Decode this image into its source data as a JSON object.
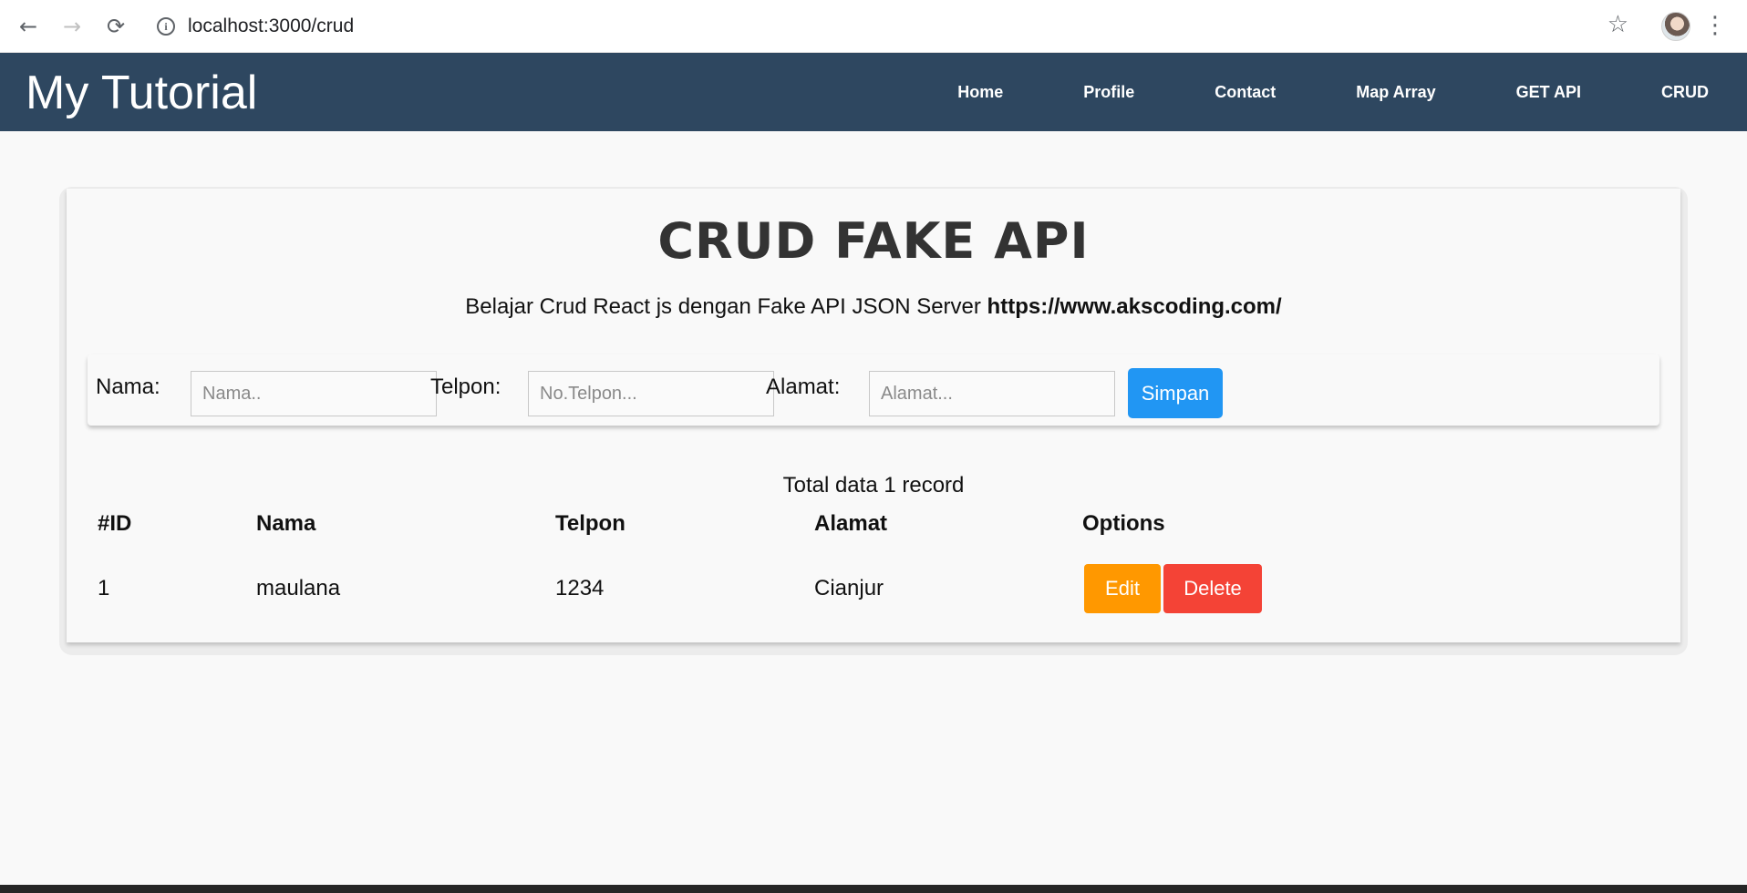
{
  "browser": {
    "url": "localhost:3000/crud",
    "back_icon": "←",
    "forward_icon": "→",
    "reload_icon": "⟳",
    "star_icon": "☆",
    "menu_icon": "⋮"
  },
  "navbar": {
    "brand": "My Tutorial",
    "links": [
      "Home",
      "Profile",
      "Contact",
      "Map Array",
      "GET API",
      "CRUD"
    ],
    "background": "#2e4760"
  },
  "page": {
    "title": "CRUD FAKE API",
    "subtitle_text": "Belajar Crud React js dengan Fake API JSON Server",
    "subtitle_link": "https://www.akscoding.com/"
  },
  "form": {
    "nama_label": "Nama:",
    "nama_placeholder": "Nama..",
    "telpon_label": "Telpon:",
    "telpon_placeholder": "No.Telpon...",
    "alamat_label": "Alamat:",
    "alamat_placeholder": "Alamat...",
    "submit_label": "Simpan",
    "submit_color": "#2196f3"
  },
  "table": {
    "total_text": "Total data 1 record",
    "headers": [
      "#ID",
      "Nama",
      "Telpon",
      "Alamat",
      "Options"
    ],
    "rows": [
      {
        "id": "1",
        "nama": "maulana",
        "telpon": "1234",
        "alamat": "Cianjur",
        "edit_label": "Edit",
        "delete_label": "Delete"
      }
    ],
    "edit_color": "#ff9800",
    "delete_color": "#f44336"
  }
}
